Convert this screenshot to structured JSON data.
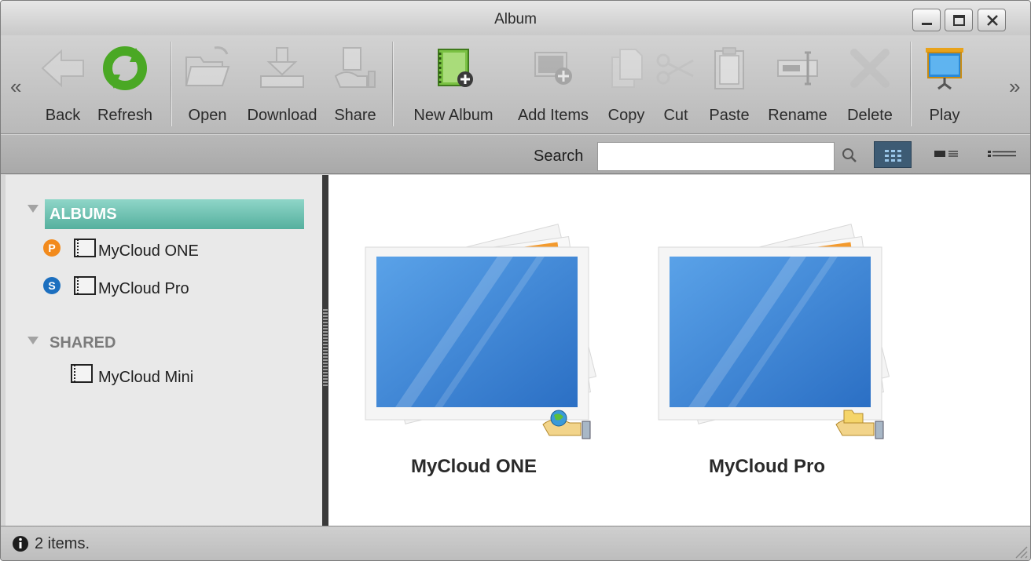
{
  "window": {
    "title": "Album"
  },
  "toolbar": {
    "buttons": [
      {
        "id": "back",
        "label": "Back",
        "icon": "back-arrow-icon",
        "enabled": false
      },
      {
        "id": "refresh",
        "label": "Refresh",
        "icon": "refresh-icon",
        "enabled": true
      },
      {
        "id": "open",
        "label": "Open",
        "icon": "folder-open-icon",
        "enabled": false
      },
      {
        "id": "download",
        "label": "Download",
        "icon": "download-icon",
        "enabled": false
      },
      {
        "id": "share",
        "label": "Share",
        "icon": "share-hand-icon",
        "enabled": false
      },
      {
        "id": "new_album",
        "label": "New Album",
        "icon": "new-album-icon",
        "enabled": true
      },
      {
        "id": "add_items",
        "label": "Add Items",
        "icon": "add-items-icon",
        "enabled": false
      },
      {
        "id": "copy",
        "label": "Copy",
        "icon": "copy-icon",
        "enabled": false
      },
      {
        "id": "cut",
        "label": "Cut",
        "icon": "scissors-icon",
        "enabled": false
      },
      {
        "id": "paste",
        "label": "Paste",
        "icon": "clipboard-icon",
        "enabled": false
      },
      {
        "id": "rename",
        "label": "Rename",
        "icon": "rename-icon",
        "enabled": false
      },
      {
        "id": "delete",
        "label": "Delete",
        "icon": "delete-x-icon",
        "enabled": false
      },
      {
        "id": "play",
        "label": "Play",
        "icon": "slideshow-screen-icon",
        "enabled": true
      }
    ]
  },
  "search": {
    "label": "Search",
    "value": "",
    "placeholder": ""
  },
  "sidebar": {
    "albums_heading": "ALBUMS",
    "shared_heading": "SHARED",
    "albums": [
      {
        "name": "MyCloud ONE",
        "badge": "P",
        "badge_color": "#f28a1c"
      },
      {
        "name": "MyCloud Pro",
        "badge": "S",
        "badge_color": "#1c6fbf"
      }
    ],
    "shared": [
      {
        "name": "MyCloud Mini"
      }
    ]
  },
  "content": {
    "albums": [
      {
        "name": "MyCloud ONE",
        "share_icon": "globe-share-icon"
      },
      {
        "name": "MyCloud Pro",
        "share_icon": "folder-share-icon"
      }
    ]
  },
  "status": {
    "text": "2 items."
  },
  "colors": {
    "selection": "#55b09e",
    "accent_blue": "#3d5b74",
    "badge_orange": "#f28a1c",
    "badge_blue": "#1c6fbf"
  }
}
